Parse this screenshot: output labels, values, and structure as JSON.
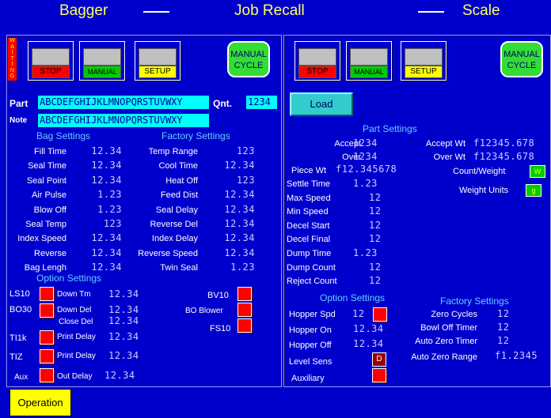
{
  "header": {
    "left_title": "Bagger",
    "center_title": "Job Recall",
    "right_title": "Scale"
  },
  "status": {
    "waiting_letters": [
      "W",
      "A",
      "I",
      "T",
      "I",
      "N",
      "G"
    ]
  },
  "left_buttons": {
    "stop": "STOP",
    "manual": "MANUAL",
    "setup": "SETUP",
    "cycle_line1": "MANUAL",
    "cycle_line2": "CYCLE"
  },
  "right_buttons": {
    "stop": "STOP",
    "manual": "MANUAL",
    "setup": "SETUP",
    "cycle_line1": "MANUAL",
    "cycle_line2": "CYCLE"
  },
  "part": {
    "label": "Part",
    "value": "ABCDEFGHIJKLMNOPQRSTUVWXY",
    "qnt_label": "Qnt.",
    "qnt_value": "1234"
  },
  "note": {
    "label": "Note",
    "value": "ABCDEFGHIJKLMNOPQRSTUVWXY"
  },
  "bag_settings": {
    "header": "Bag Settings",
    "rows": [
      {
        "label": "Fill Time",
        "value": "12.34"
      },
      {
        "label": "Seal Time",
        "value": "12.34"
      },
      {
        "label": "Seal Point",
        "value": "12.34"
      },
      {
        "label": "Air Pulse",
        "value": "1.23"
      },
      {
        "label": "Blow Off",
        "value": "1.23"
      },
      {
        "label": "Seal Temp",
        "value": "123"
      },
      {
        "label": "Index Speed",
        "value": "12.34"
      },
      {
        "label": "Reverse",
        "value": "12.34"
      },
      {
        "label": "Bag Lengh",
        "value": "12.34"
      }
    ]
  },
  "factory_settings_left": {
    "header": "Factory Settings",
    "rows": [
      {
        "label": "Temp Range",
        "value": "123"
      },
      {
        "label": "Cool Time",
        "value": "12.34"
      },
      {
        "label": "Heat Off",
        "value": "123"
      },
      {
        "label": "Feed Dist",
        "value": "12.34"
      },
      {
        "label": "Seal Delay",
        "value": "12.34"
      },
      {
        "label": "Reverse Del",
        "value": "12.34"
      },
      {
        "label": "Index Delay",
        "value": "12.34"
      },
      {
        "label": "Reverse Speed",
        "value": "12.34"
      },
      {
        "label": "Twin Seal",
        "value": "1.23"
      }
    ]
  },
  "option_settings_left": {
    "header": "Option Settings",
    "ls10": "LS10",
    "down_tm_label": "Down Tm",
    "down_tm": "12.34",
    "bo30": "BO30",
    "down_del_label": "Down Del",
    "down_del": "12.34",
    "close_del_label": "Close Del",
    "close_del": "12.34",
    "ti1k": "TI1k",
    "print_delay_label": "Print Delay",
    "print_delay": "12.34",
    "tiz": "TIZ",
    "print_delay2_label": "Print Delay",
    "print_delay2": "12.34",
    "aux": "Aux",
    "out_delay_label": "Out Delay",
    "out_delay": "12.34",
    "bv10": "BV10",
    "bo_blower": "BO Blower",
    "fs10": "FS10"
  },
  "load_button": "Load",
  "part_settings": {
    "header": "Part Settings",
    "accept_label": "Accept",
    "accept": "1234",
    "over_label": "Over",
    "over": "1234",
    "piece_wt_label": "Piece Wt",
    "piece_wt": "f12.345678",
    "accept_wt_label": "Accept Wt",
    "accept_wt": "f12345.678",
    "over_wt_label": "Over Wt",
    "over_wt": "f12345.678",
    "count_weight_label": "Count/Weight",
    "count_weight_btn": "W",
    "weight_units_label": "Weight Units",
    "weight_units_btn": "g",
    "rows": [
      {
        "label": "Settle Time",
        "value": "1.23"
      },
      {
        "label": "Max Speed",
        "value": "12"
      },
      {
        "label": "Min Speed",
        "value": "12"
      },
      {
        "label": "Decel Start",
        "value": "12"
      },
      {
        "label": "Decel Final",
        "value": "12"
      },
      {
        "label": "Dump Time",
        "value": "1.23"
      },
      {
        "label": "Dump Count",
        "value": "12"
      },
      {
        "label": "Reject Count",
        "value": "12"
      }
    ]
  },
  "option_settings_right": {
    "header": "Option Settings",
    "hopper_spd_label": "Hopper Spd",
    "hopper_spd": "12",
    "hopper_on_label": "Hopper On",
    "hopper_on": "12.34",
    "hopper_off_label": "Hopper Off",
    "hopper_off": "12.34",
    "level_sens_label": "Level Sens",
    "level_sens_btn": "D",
    "auxiliary_label": "Auxiliary"
  },
  "factory_settings_right": {
    "header": "Factory Settings",
    "zero_cycles_label": "Zero Cycles",
    "zero_cycles": "12",
    "bowl_off_label": "Bowl Off Timer",
    "bowl_off": "12",
    "auto_zero_timer_label": "Auto Zero Timer",
    "auto_zero_timer": "12",
    "auto_zero_range_label": "Auto Zero Range",
    "auto_zero_range": "f1.2345"
  },
  "footer": {
    "operation": "Operation"
  }
}
